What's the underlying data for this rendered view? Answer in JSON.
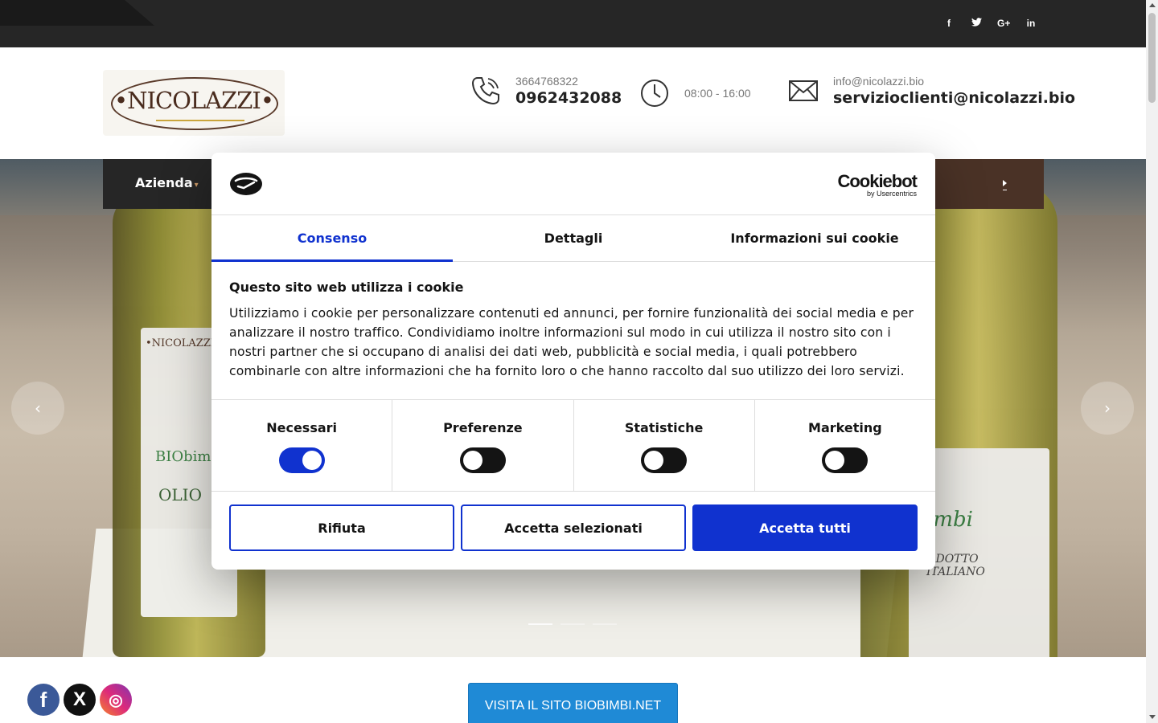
{
  "topbar": {
    "social": [
      "f",
      "t",
      "G+",
      "in"
    ]
  },
  "header": {
    "logo_text": "•NICOLAZZI•",
    "phone_small": "3664768322",
    "phone_big": "0962432088",
    "hours": "08:00 - 16:00",
    "email_small": "info@nicolazzi.bio",
    "email_big": "servizioclienti@nicolazzi.bio"
  },
  "nav": {
    "item1": "Azienda",
    "caret": "▾"
  },
  "slider": {
    "left_label_brand": "•NICOLAZZI",
    "left_label_word1": "BIObimbi",
    "left_label_word2": "OLIO",
    "right_label_word1": "imbi",
    "right_label_word2": "ODOTTO\nITALIANO",
    "prev": "‹",
    "next": "›"
  },
  "footer": {
    "cta": "VISITA IL SITO BIOBIMBI.NET",
    "fb": "f",
    "x": "X",
    "ig": "◎"
  },
  "cookie": {
    "brand_name": "Cookiebot",
    "brand_sub": "by Usercentrics",
    "tabs": [
      "Consenso",
      "Dettagli",
      "Informazioni sui cookie"
    ],
    "title": "Questo sito web utilizza i cookie",
    "text": "Utilizziamo i cookie per personalizzare contenuti ed annunci, per fornire funzionalità dei social media e per analizzare il nostro traffico. Condividiamo inoltre informazioni sul modo in cui utilizza il nostro sito con i nostri partner che si occupano di analisi dei dati web, pubblicità e social media, i quali potrebbero combinarle con altre informazioni che ha fornito loro o che hanno raccolto dal suo utilizzo dei loro servizi.",
    "categories": [
      {
        "label": "Necessari",
        "on": true
      },
      {
        "label": "Preferenze",
        "on": false
      },
      {
        "label": "Statistiche",
        "on": false
      },
      {
        "label": "Marketing",
        "on": false
      }
    ],
    "buttons": {
      "reject": "Rifiuta",
      "accept_selected": "Accetta selezionati",
      "accept_all": "Accetta tutti"
    },
    "accent": "#1032cf"
  }
}
